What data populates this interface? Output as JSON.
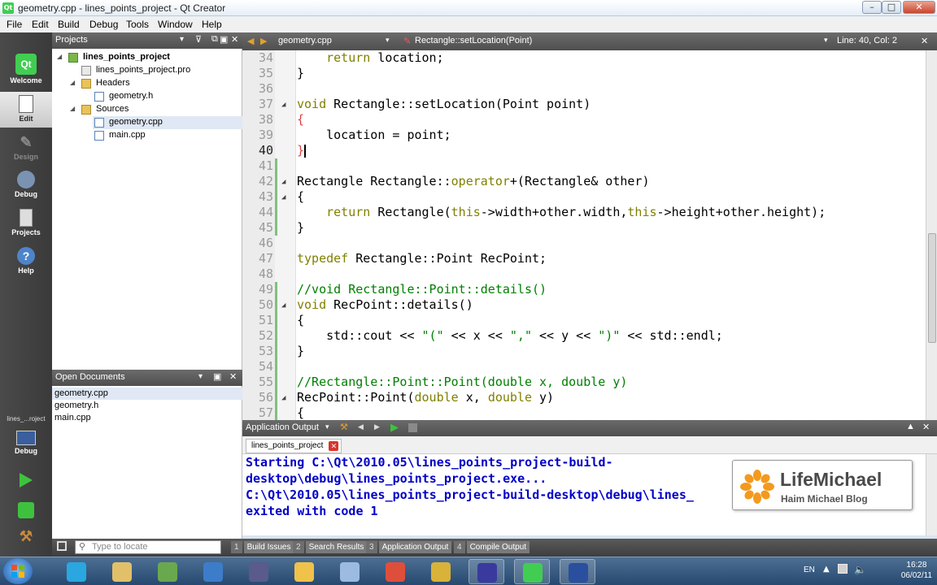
{
  "window": {
    "title": "geometry.cpp - lines_points_project - Qt Creator"
  },
  "menu": [
    "File",
    "Edit",
    "Build",
    "Debug",
    "Tools",
    "Window",
    "Help"
  ],
  "modes": [
    {
      "label": "Welcome"
    },
    {
      "label": "Edit"
    },
    {
      "label": "Design"
    },
    {
      "label": "Debug"
    },
    {
      "label": "Projects"
    },
    {
      "label": "Help"
    }
  ],
  "kit": {
    "label": "lines_...roject",
    "debug_label": "Debug"
  },
  "projects_panel": {
    "title": "Projects",
    "tree": [
      {
        "label": "lines_points_project"
      },
      {
        "label": "lines_points_project.pro"
      },
      {
        "label": "Headers"
      },
      {
        "label": "geometry.h"
      },
      {
        "label": "Sources"
      },
      {
        "label": "geometry.cpp"
      },
      {
        "label": "main.cpp"
      }
    ]
  },
  "open_documents": {
    "title": "Open Documents",
    "items": [
      "geometry.cpp",
      "geometry.h",
      "main.cpp"
    ]
  },
  "editor_header": {
    "file": "geometry.cpp",
    "symbol": "Rectangle::setLocation(Point)",
    "position": "Line: 40, Col: 2"
  },
  "editor": {
    "line_numbers": [
      "34",
      "35",
      "36",
      "37",
      "38",
      "39",
      "40",
      "41",
      "42",
      "43",
      "44",
      "45",
      "46",
      "47",
      "48",
      "49",
      "50",
      "51",
      "52",
      "53",
      "54",
      "55",
      "56",
      "57"
    ]
  },
  "output_panel": {
    "title": "Application Output",
    "tab": "lines_points_project",
    "lines": [
      "Starting C:\\Qt\\2010.05\\lines_points_project-build-",
      "desktop\\debug\\lines_points_project.exe...",
      "C:\\Qt\\2010.05\\lines_points_project-build-desktop\\debug\\lines_",
      "exited with code 1"
    ]
  },
  "watermark": {
    "brand": "LifeMichael",
    "subtitle": "Haim Michael Blog"
  },
  "status_bar": {
    "locate_placeholder": "Type to locate",
    "buttons": [
      {
        "num": "1",
        "label": "Build Issues"
      },
      {
        "num": "2",
        "label": "Search Results"
      },
      {
        "num": "3",
        "label": "Application Output"
      },
      {
        "num": "4",
        "label": "Compile Output"
      }
    ]
  },
  "taskbar": {
    "lang": "EN",
    "time": "16:28",
    "date": "06/02/11",
    "apps": [
      "skype-icon",
      "explorer-icon",
      "calculator-icon",
      "sync-icon",
      "itunes-icon",
      "notepad-icon",
      "paint-icon",
      "chrome-icon",
      "bird-icon",
      "media-player-icon",
      "qt-icon",
      "app-icon"
    ]
  },
  "colors": {
    "keyword": "#808000",
    "comment": "#008000",
    "brace_match": "#e04040",
    "output_text": "#0000c8",
    "qt_green": "#41cd52"
  }
}
